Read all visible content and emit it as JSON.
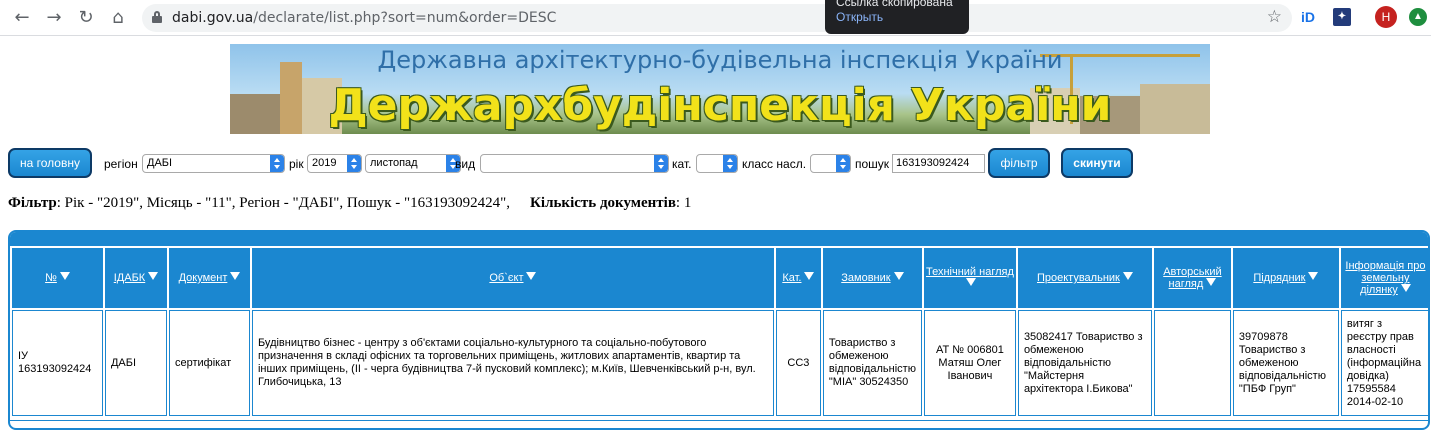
{
  "browser": {
    "url_host": "dabi.gov.ua",
    "url_path": "/declarate/list.php?sort=num&order=DESC",
    "toast_title": "Ссылка скопирована",
    "toast_action": "Открыть",
    "ext_id_label": "iD",
    "avatar_letter": "H"
  },
  "banner": {
    "title_small": "Державна архітектурно-будівельна інспекція України",
    "title_big": "Держархбудінспекція України"
  },
  "controls": {
    "home_button": "на головну",
    "region_label": "регіон",
    "region_value": "ДАБІ",
    "year_label": "рік",
    "year_value": "2019",
    "month_value": "листопад",
    "type_label": "вид",
    "type_value": "",
    "cat_label": "кат.",
    "cat_value": "",
    "class_label": "класс насл.",
    "class_value": "",
    "search_label": "пошук",
    "search_value": "163193092424",
    "filter_button": "фільтр",
    "reset_button": "скинути"
  },
  "filter_summary": {
    "filter_label": "Фільтр",
    "filter_text": ": Рік - \"2019\", Місяць - \"11\", Регіон - \"ДАБІ\", Пошук - \"163193092424\",",
    "count_label": "Кількість документів",
    "count_value": ": 1"
  },
  "table": {
    "headers": [
      "№",
      "ІДАБК",
      "Документ",
      "Об`єкт",
      "Кат.",
      "Замовник",
      "Технічний нагляд",
      "Проектувальник",
      "Авторський нагляд",
      "Підрядник",
      "Інформація про земельну ділянку"
    ],
    "rows": [
      {
        "num": "ІУ 163193092424",
        "idabk": "ДАБІ",
        "document": "сертифікат",
        "object": "Будівництво бізнес - центру з об'єктами соціально-культурного та соціально-побутового призначення в складі офісних та торговельних приміщень, житлових апартаментів, квартир та інших приміщень, (ІІ - черга будівництва 7-й пусковий комплекс); м.Київ, Шевченківський р-н, вул. Глибочицька, 13",
        "cat": "СС3",
        "customer": "Товариство з обмеженою відповідальністю \"МІА\" 30524350",
        "tech_supervision": "АТ № 006801 Матяш Олег Іванович",
        "designer": "35082417 Товариство з обмеженою відповідальністю \"Майстерня архітектора І.Бикова\"",
        "author_supervision": "",
        "contractor": "39709878 Товариство з обмеженою відповідальністю \"ПБФ Груп\"",
        "land_info": "витяг з реєстру прав власності (інформаційна довідка) 17595584 2014-02-10"
      }
    ]
  },
  "colors": {
    "accent": "#1b87d0",
    "button_border": "#0d3a66"
  }
}
